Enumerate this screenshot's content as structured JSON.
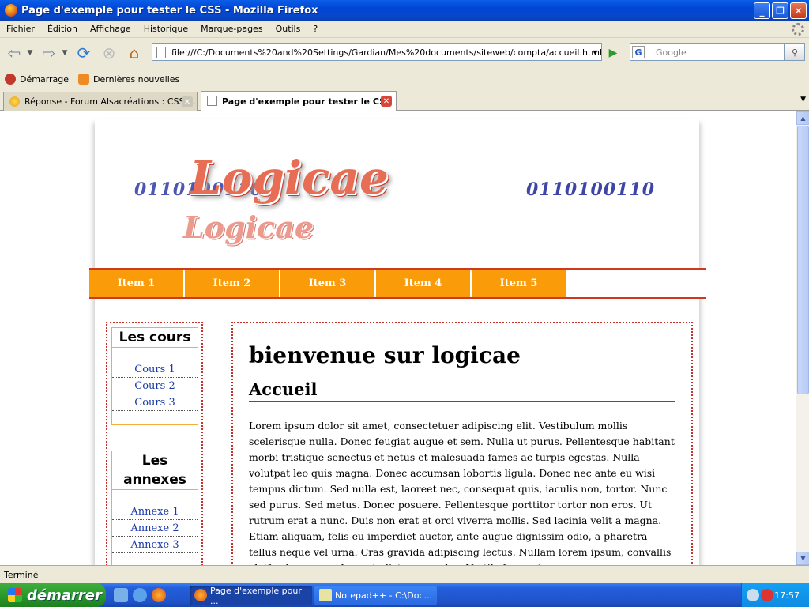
{
  "window": {
    "title": "Page d'exemple pour tester le CSS - Mozilla Firefox"
  },
  "menu": [
    "Fichier",
    "Édition",
    "Affichage",
    "Historique",
    "Marque-pages",
    "Outils",
    "?"
  ],
  "navbar": {
    "url": "file:///C:/Documents%20and%20Settings/Gardian/Mes%20documents/siteweb/compta/accueil.html",
    "search_placeholder": "Google"
  },
  "bookmarks": [
    "Démarrage",
    "Dernières nouvelles"
  ],
  "tabs": [
    {
      "label": "Réponse - Forum Alsacréations : CSS ..."
    },
    {
      "label": "Page d'exemple pour tester le CSS"
    }
  ],
  "page": {
    "binary_left": "0110100110",
    "binary_right": "0110100110",
    "logo": "Logicae",
    "logo_reflection": "Logicae",
    "nav_items": [
      "Item 1",
      "Item 2",
      "Item 3",
      "Item 4",
      "Item 5"
    ],
    "sidebar": {
      "cours_title": "Les cours",
      "cours_links": [
        "Cours 1",
        "Cours 2",
        "Cours 3"
      ],
      "annexes_title": "Les annexes",
      "annexes_links": [
        "Annexe 1",
        "Annexe 2",
        "Annexe 3"
      ]
    },
    "main": {
      "title": "bienvenue sur logicae",
      "section": "Accueil",
      "body": "Lorem ipsum dolor sit amet, consectetuer adipiscing elit. Vestibulum mollis scelerisque nulla. Donec feugiat augue et sem. Nulla ut purus. Pellentesque habitant morbi tristique senectus et netus et malesuada fames ac turpis egestas. Nulla volutpat leo quis magna. Donec accumsan lobortis ligula. Donec nec ante eu wisi tempus dictum. Sed nulla est, laoreet nec, consequat quis, iaculis non, tortor. Nunc sed purus. Sed metus. Donec posuere. Pellentesque porttitor tortor non eros. Ut rutrum erat a nunc. Duis non erat et orci viverra mollis. Sed lacinia velit a magna. Etiam aliquam, felis eu imperdiet auctor, ante augue dignissim odio, a pharetra tellus neque vel urna. Cras gravida adipiscing lectus. Nullam lorem ipsum, convallis eleifend, congue placerat, dictum non, leo. Vestibulum ante"
    }
  },
  "status": "Terminé",
  "taskbar": {
    "start": "démarrer",
    "tasks": [
      "Page d'exemple pour ...",
      "Notepad++ - C:\\Doc..."
    ],
    "clock": "17:57"
  },
  "colors": {
    "menu_orange": "#fa9b0a",
    "accent_red": "#cc3b1e",
    "green_rule": "#1f7a1f"
  }
}
